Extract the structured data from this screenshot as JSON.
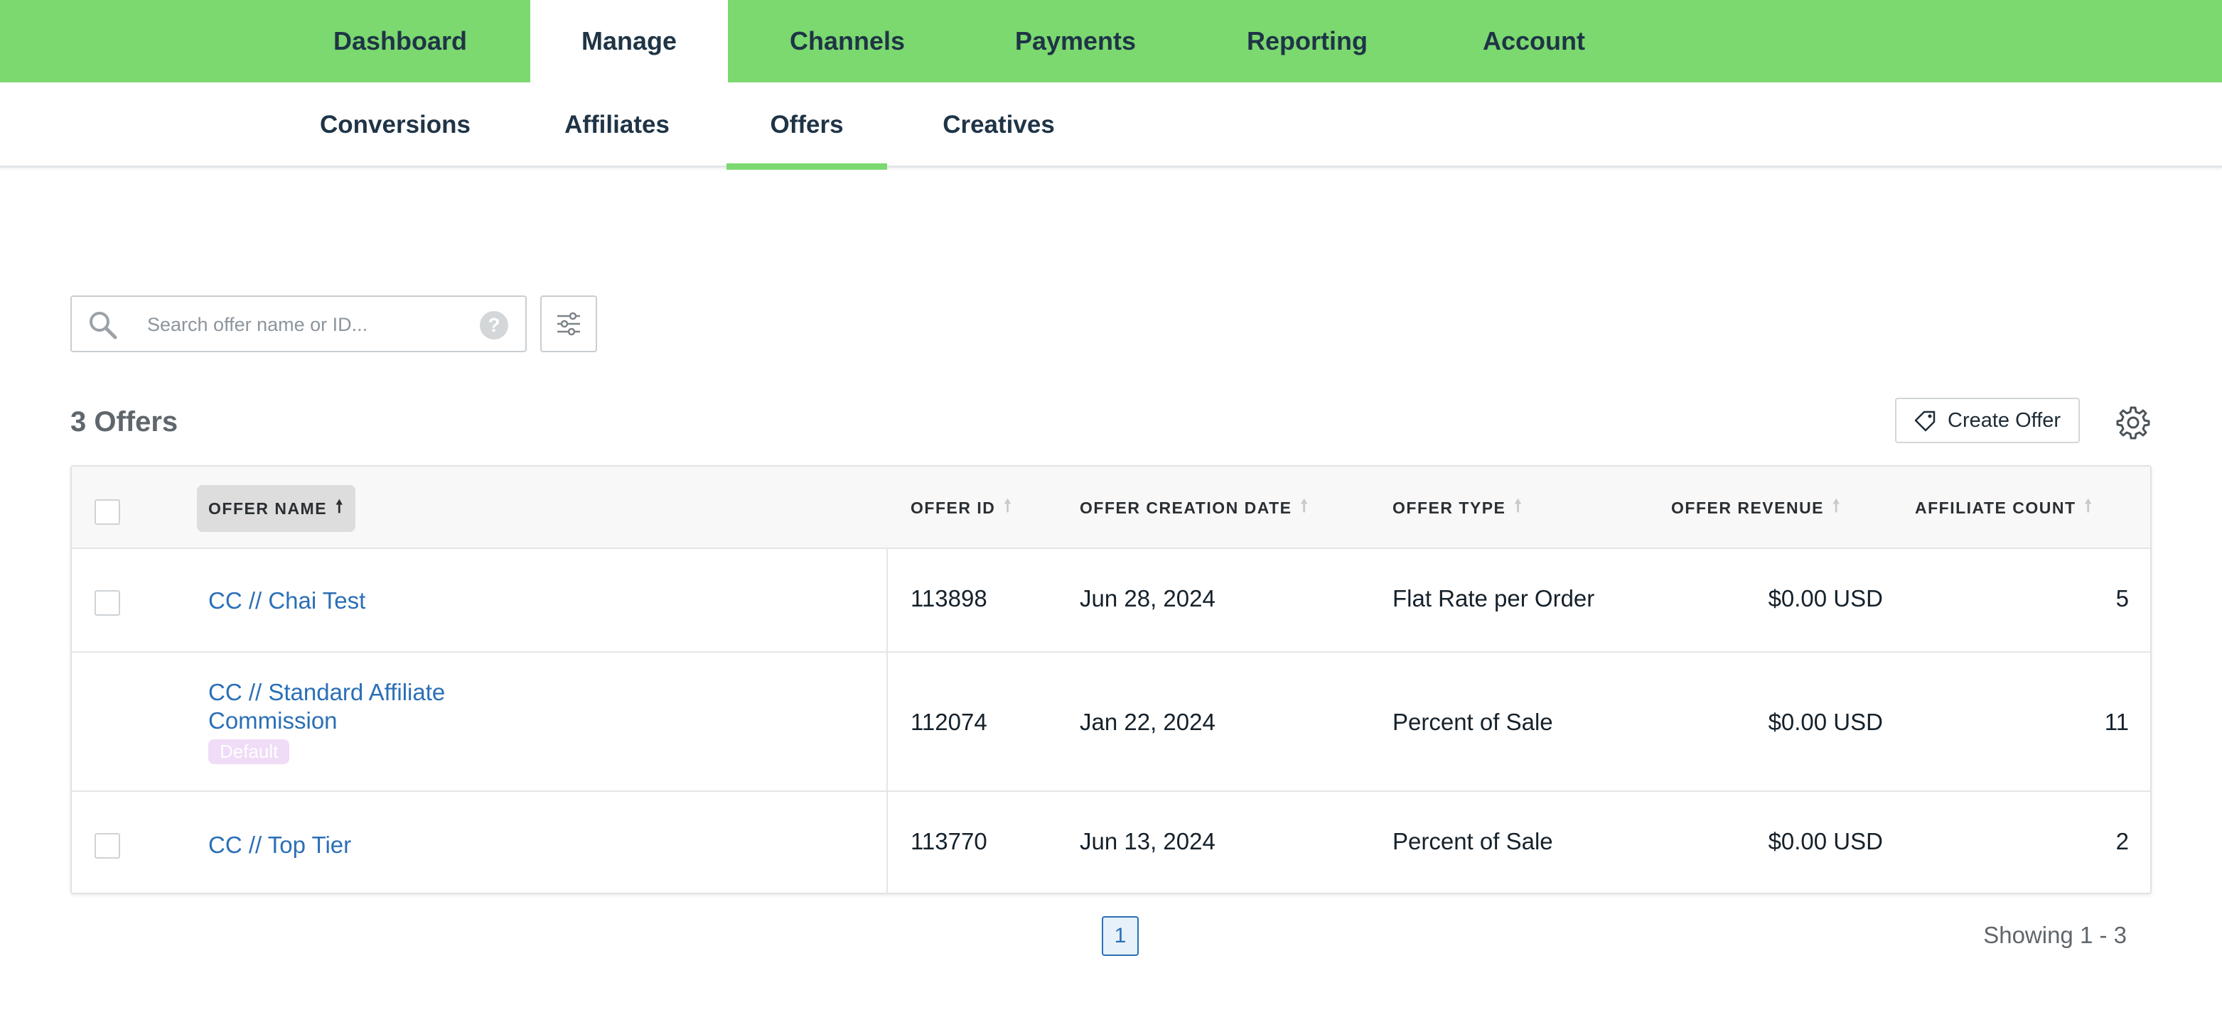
{
  "top_nav": {
    "tabs": [
      {
        "label": "Dashboard"
      },
      {
        "label": "Manage"
      },
      {
        "label": "Channels"
      },
      {
        "label": "Payments"
      },
      {
        "label": "Reporting"
      },
      {
        "label": "Account"
      }
    ],
    "active": "Manage"
  },
  "sub_nav": {
    "tabs": [
      {
        "label": "Conversions"
      },
      {
        "label": "Affiliates"
      },
      {
        "label": "Offers"
      },
      {
        "label": "Creatives"
      }
    ],
    "active": "Offers"
  },
  "search": {
    "placeholder": "Search offer name or ID...",
    "value": "",
    "help_label": "?"
  },
  "list": {
    "title": "3 Offers",
    "create_label": "Create Offer"
  },
  "table": {
    "headers": {
      "offer_name": "OFFER NAME",
      "offer_id": "OFFER ID",
      "creation_date": "OFFER CREATION DATE",
      "offer_type": "OFFER TYPE",
      "revenue": "OFFER REVENUE",
      "affiliate_count": "AFFILIATE COUNT"
    },
    "sorted_by": "OFFER NAME",
    "rows": [
      {
        "name": "CC // Chai Test",
        "badge": "",
        "id": "113898",
        "date": "Jun 28, 2024",
        "type": "Flat Rate per Order",
        "revenue": "$0.00 USD",
        "count": "5"
      },
      {
        "name": "CC // Standard Affiliate Commission",
        "name_line1": "CC // Standard Affiliate",
        "name_line2": "Commission",
        "badge": "Default",
        "id": "112074",
        "date": "Jan 22, 2024",
        "type": "Percent of Sale",
        "revenue": "$0.00 USD",
        "count": "11"
      },
      {
        "name": "CC // Top Tier",
        "badge": "",
        "id": "113770",
        "date": "Jun 13, 2024",
        "type": "Percent of Sale",
        "revenue": "$0.00 USD",
        "count": "2"
      }
    ]
  },
  "pagination": {
    "current_page": "1",
    "showing": "Showing 1 - 3"
  },
  "colors": {
    "nav_green": "#7bd96f",
    "link_blue": "#2b6fb6",
    "badge_purple": "#f0dcf7"
  }
}
